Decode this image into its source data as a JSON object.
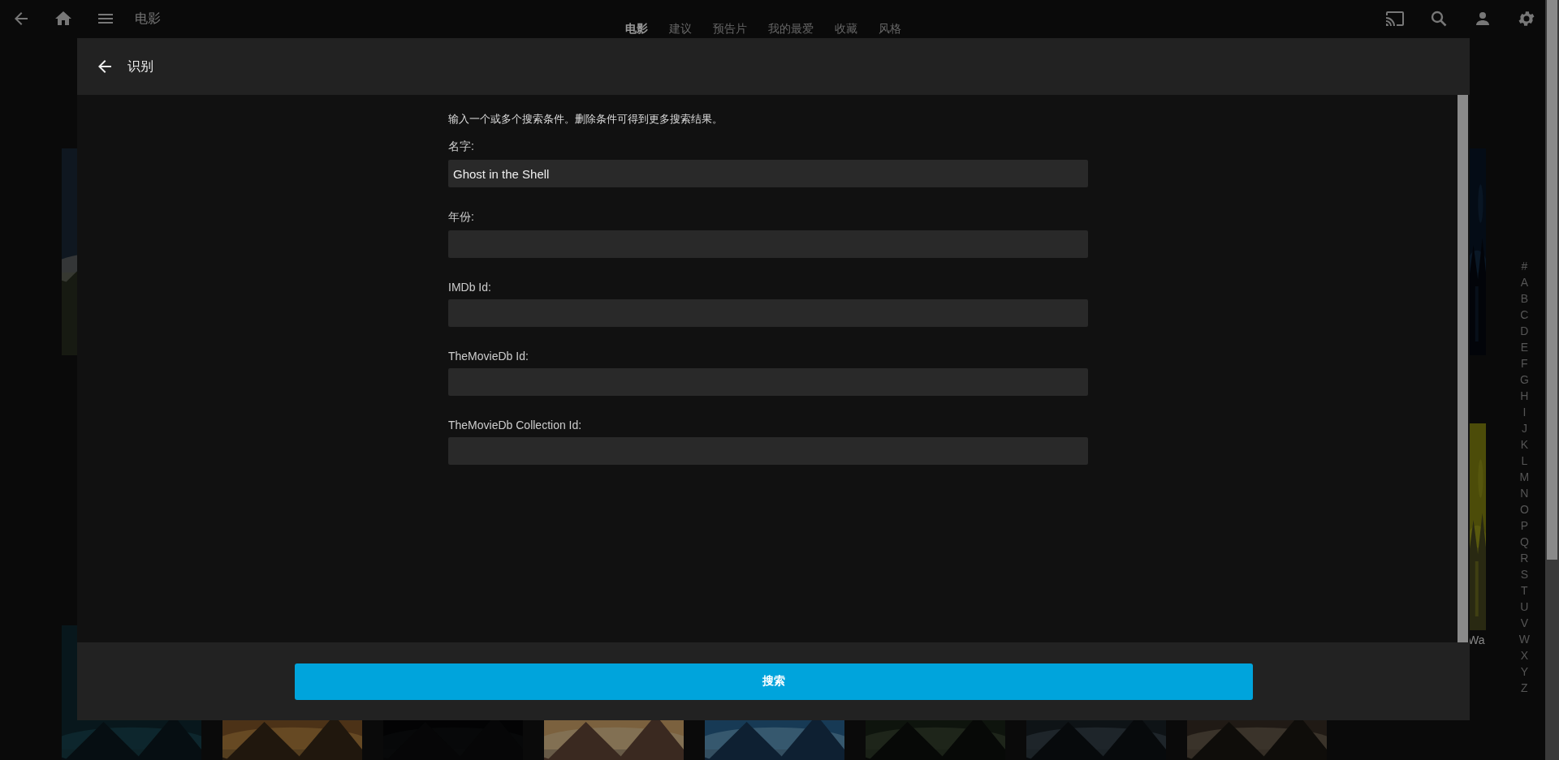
{
  "topbar": {
    "title": "电影",
    "nav": [
      {
        "label": "电影",
        "selected": true
      },
      {
        "label": "建议",
        "selected": false
      },
      {
        "label": "预告片",
        "selected": false
      },
      {
        "label": "我的最爱",
        "selected": false
      },
      {
        "label": "收藏",
        "selected": false
      },
      {
        "label": "风格",
        "selected": false
      }
    ]
  },
  "library": {
    "caption": "Wa",
    "alphabet": [
      "#",
      "A",
      "B",
      "C",
      "D",
      "E",
      "F",
      "G",
      "H",
      "I",
      "J",
      "K",
      "L",
      "M",
      "N",
      "O",
      "P",
      "Q",
      "R",
      "S",
      "T",
      "U",
      "V",
      "W",
      "X",
      "Y",
      "Z"
    ]
  },
  "dialog": {
    "title": "识别",
    "description": "输入一个或多个搜索条件。删除条件可得到更多搜索结果。",
    "fields": [
      {
        "label": "名字:",
        "value": "Ghost in the Shell"
      },
      {
        "label": "年份:"
      },
      {
        "label": "IMDb Id:"
      },
      {
        "label": "TheMovieDb Id:"
      },
      {
        "label": "TheMovieDb Collection Id:"
      }
    ],
    "button": "搜索"
  }
}
